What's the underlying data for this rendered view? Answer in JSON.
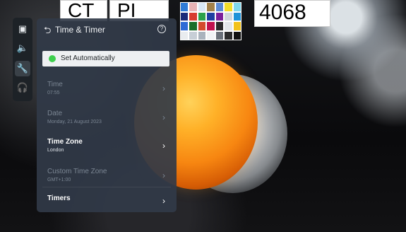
{
  "overlay": {
    "card1_text": "CT",
    "card2_text": "PI",
    "card3_text": "4068",
    "palette_colors": [
      "#2f7bd6",
      "#e7b3b5",
      "#d9e8f5",
      "#a2814a",
      "#5a8bd6",
      "#f3dc2a",
      "#7fd7ec",
      "#1b2a7a",
      "#d73b2f",
      "#2ba24b",
      "#1e3fa2",
      "#7a1e9b",
      "#cfd6dd",
      "#1e93d8",
      "#2e6bd6",
      "#1b6e2b",
      "#d44a2c",
      "#c1124f",
      "#2a2a2a",
      "#e3e7ea",
      "#f2c21a",
      "#e9ecef",
      "#c7ced6",
      "#aab3bd",
      "#f1f3f5",
      "#6b717a",
      "#2c2c2c",
      "#111111"
    ]
  },
  "sidebar": {
    "items": [
      {
        "icon": "picture-icon",
        "glyph": "▣",
        "active": false
      },
      {
        "icon": "sound-icon",
        "glyph": "🔈",
        "active": false
      },
      {
        "icon": "wrench-icon",
        "glyph": "🔧",
        "active": true
      },
      {
        "icon": "headset-icon",
        "glyph": "🎧",
        "active": false
      }
    ]
  },
  "panel": {
    "back_glyph": "⮌",
    "title": "Time & Timer",
    "help_glyph": "?",
    "auto_button_label": "Set Automatically",
    "rows": [
      {
        "label": "Time",
        "sub": "07:55",
        "enabled": false
      },
      {
        "label": "Date",
        "sub": "Monday, 21 August 2023",
        "enabled": false
      },
      {
        "label": "Time Zone",
        "sub": "London",
        "enabled": true
      },
      {
        "label": "Custom Time Zone",
        "sub": "GMT+1:00",
        "enabled": false
      },
      {
        "label": "Timers",
        "sub": "",
        "enabled": true
      }
    ],
    "chevron_glyph": "›"
  }
}
